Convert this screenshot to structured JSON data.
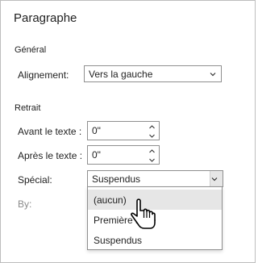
{
  "dialog": {
    "title": "Paragraphe",
    "general": {
      "section_label": "Général",
      "alignment_label": "Alignement:",
      "alignment_value": "Vers la gauche"
    },
    "indent": {
      "section_label": "Retrait",
      "before_label": "Avant le texte :",
      "before_value": "0\"",
      "after_label": "Après le texte :",
      "after_value": "0\"",
      "special_label": "Spécial:",
      "special_value": "Suspendus",
      "by_label": "By:"
    },
    "special_options": [
      "(aucun)",
      "Première ligne",
      "Suspendus"
    ],
    "highlighted_option": "(aucun)"
  },
  "icons": {
    "dropdown": "chevron-down-icon",
    "spinner": "spinner-arrows-icon",
    "pointer": "hand-pointer-icon"
  },
  "colors": {
    "border": "#8f8f8f",
    "highlight": "#e6e6e6",
    "disabled_text": "#8a8a8a"
  }
}
